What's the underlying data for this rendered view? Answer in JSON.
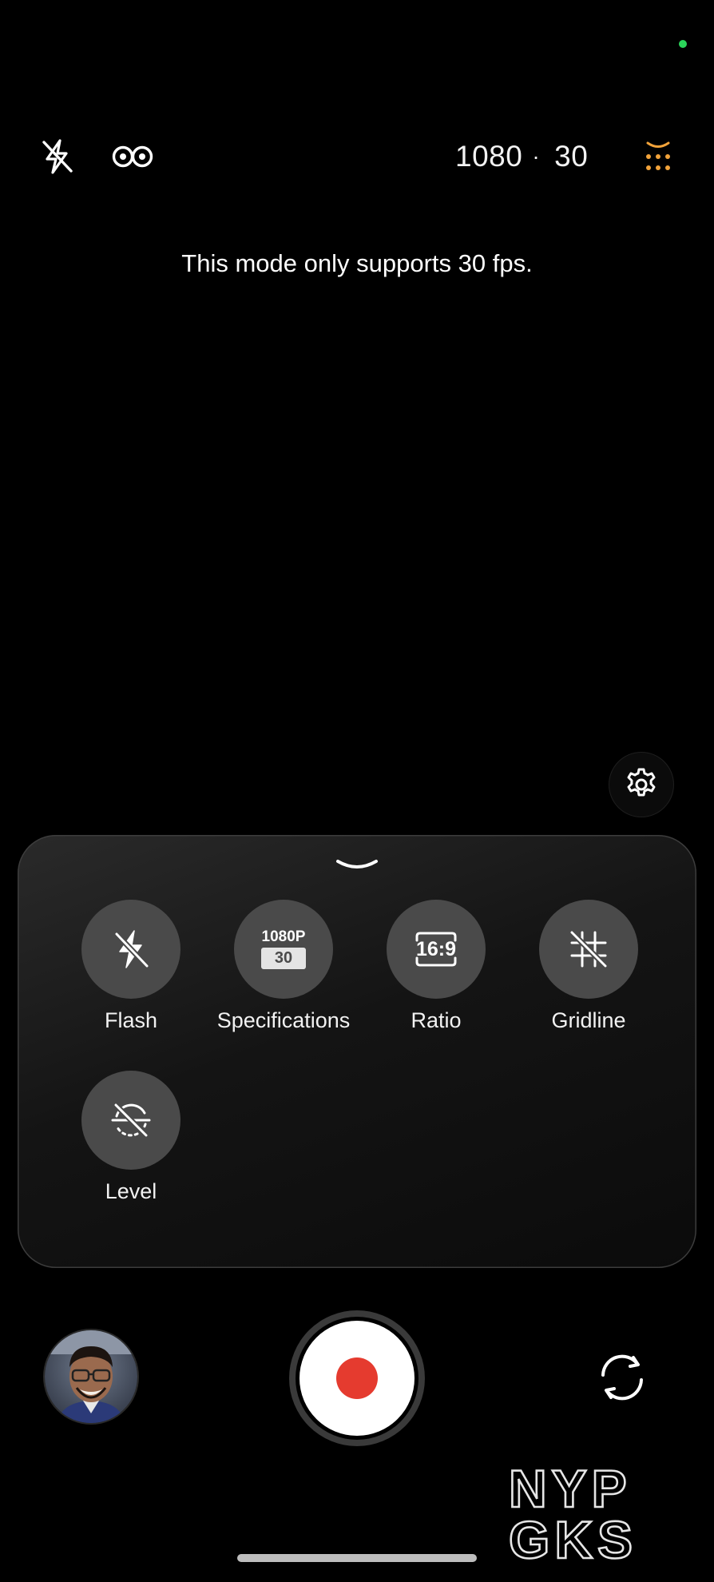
{
  "top_bar": {
    "flash_icon": "flash-off-icon",
    "live_icon": "live-photo-icon",
    "resolution": "1080",
    "separator": "·",
    "fps": "30",
    "more_icon": "more-dots-icon",
    "more_color": "#f2a33a"
  },
  "notice": "This mode only supports 30 fps.",
  "settings_icon": "gear-icon",
  "panel": {
    "handle_icon": "chevron-down-icon",
    "tiles": [
      {
        "label": "Flash",
        "icon": "flash-off-icon"
      },
      {
        "label": "Specifications",
        "icon": "specifications-icon",
        "badge_top": "1080P",
        "badge_bottom": "30"
      },
      {
        "label": "Ratio",
        "icon": "ratio-icon",
        "badge": "16:9"
      },
      {
        "label": "Gridline",
        "icon": "gridline-off-icon"
      },
      {
        "label": "Level",
        "icon": "level-off-icon"
      }
    ]
  },
  "bottom_bar": {
    "gallery": "gallery-thumbnail",
    "shutter": "record-button",
    "shutter_color": "#e53b2f",
    "flip": "switch-camera-icon"
  },
  "watermark": {
    "line1": "NYP",
    "line2": "GKS"
  }
}
